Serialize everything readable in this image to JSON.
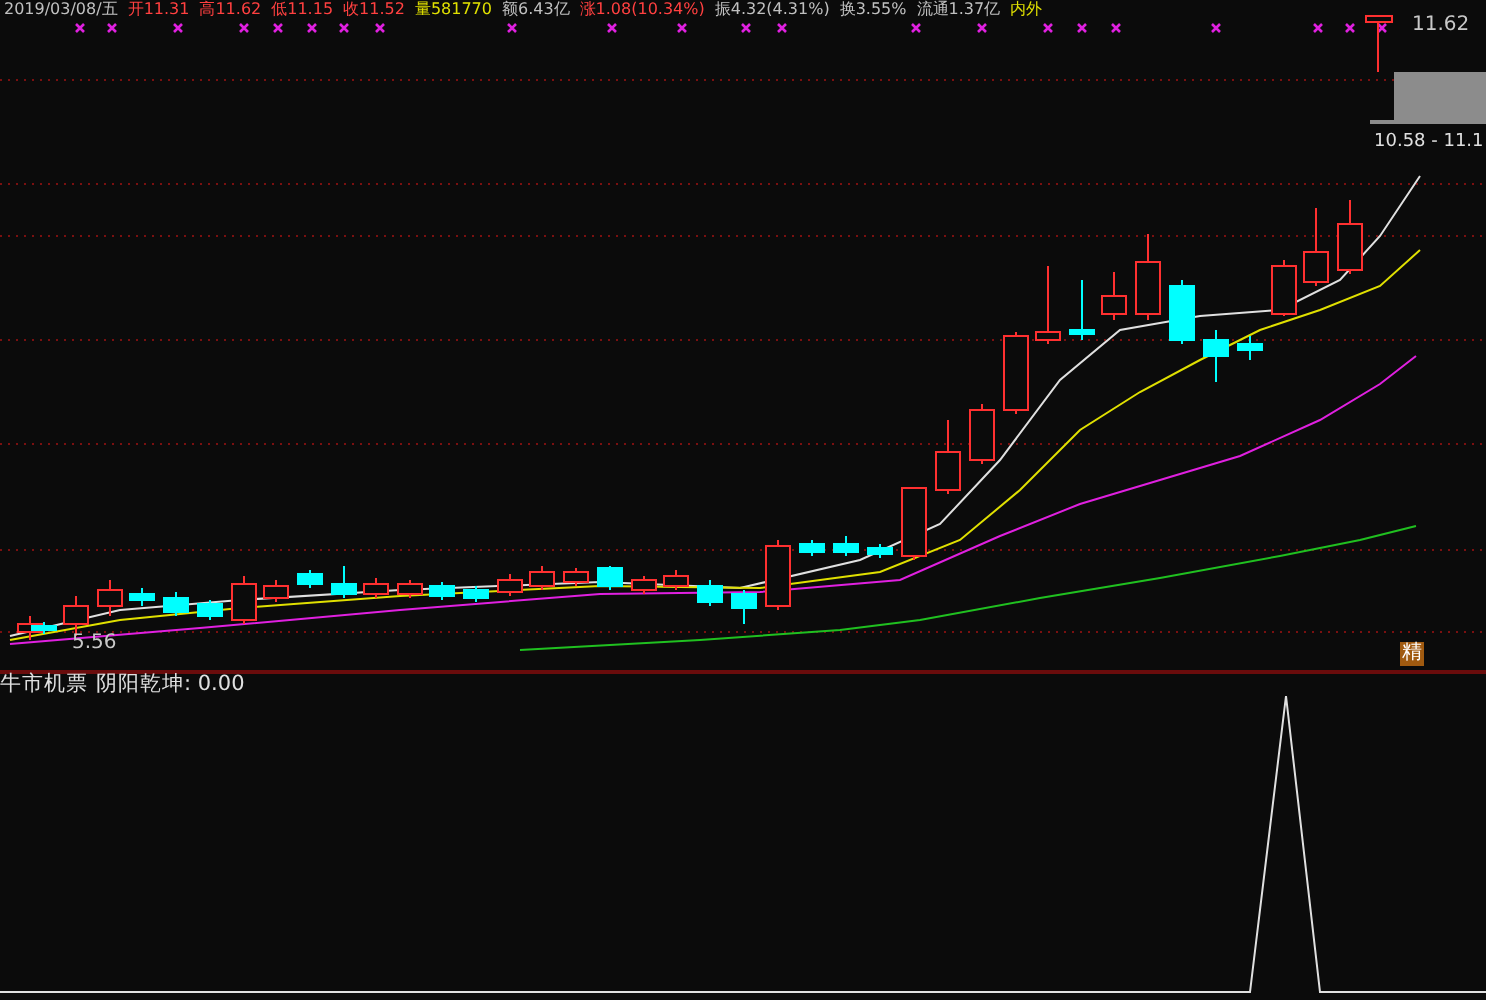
{
  "header": [
    {
      "text": "2019/03/08/五",
      "color": "#c0c0c0"
    },
    {
      "text": "开11.31",
      "color": "#ff4040"
    },
    {
      "text": "高11.62",
      "color": "#ff4040"
    },
    {
      "text": "低11.15",
      "color": "#ff4040"
    },
    {
      "text": "收11.52",
      "color": "#ff4040"
    },
    {
      "text": "量581770",
      "color": "#e0e000"
    },
    {
      "text": "额6.43亿",
      "color": "#c0c0c0"
    },
    {
      "text": "涨1.08(10.34%)",
      "color": "#ff4040"
    },
    {
      "text": "振4.32(4.31%)",
      "color": "#c0c0c0"
    },
    {
      "text": "换3.55%",
      "color": "#c0c0c0"
    },
    {
      "text": "流通1.37亿",
      "color": "#c0c0c0"
    },
    {
      "text": "内外",
      "color": "#e0e000"
    }
  ],
  "price_high_label": "11.62",
  "price_low_label": "5.56",
  "range_box": {
    "label": "10.58 - 11.1"
  },
  "badge": "精",
  "indicator": {
    "name": "牛市机票",
    "series_label": "阴阳乾坤: 0.00"
  }
}
